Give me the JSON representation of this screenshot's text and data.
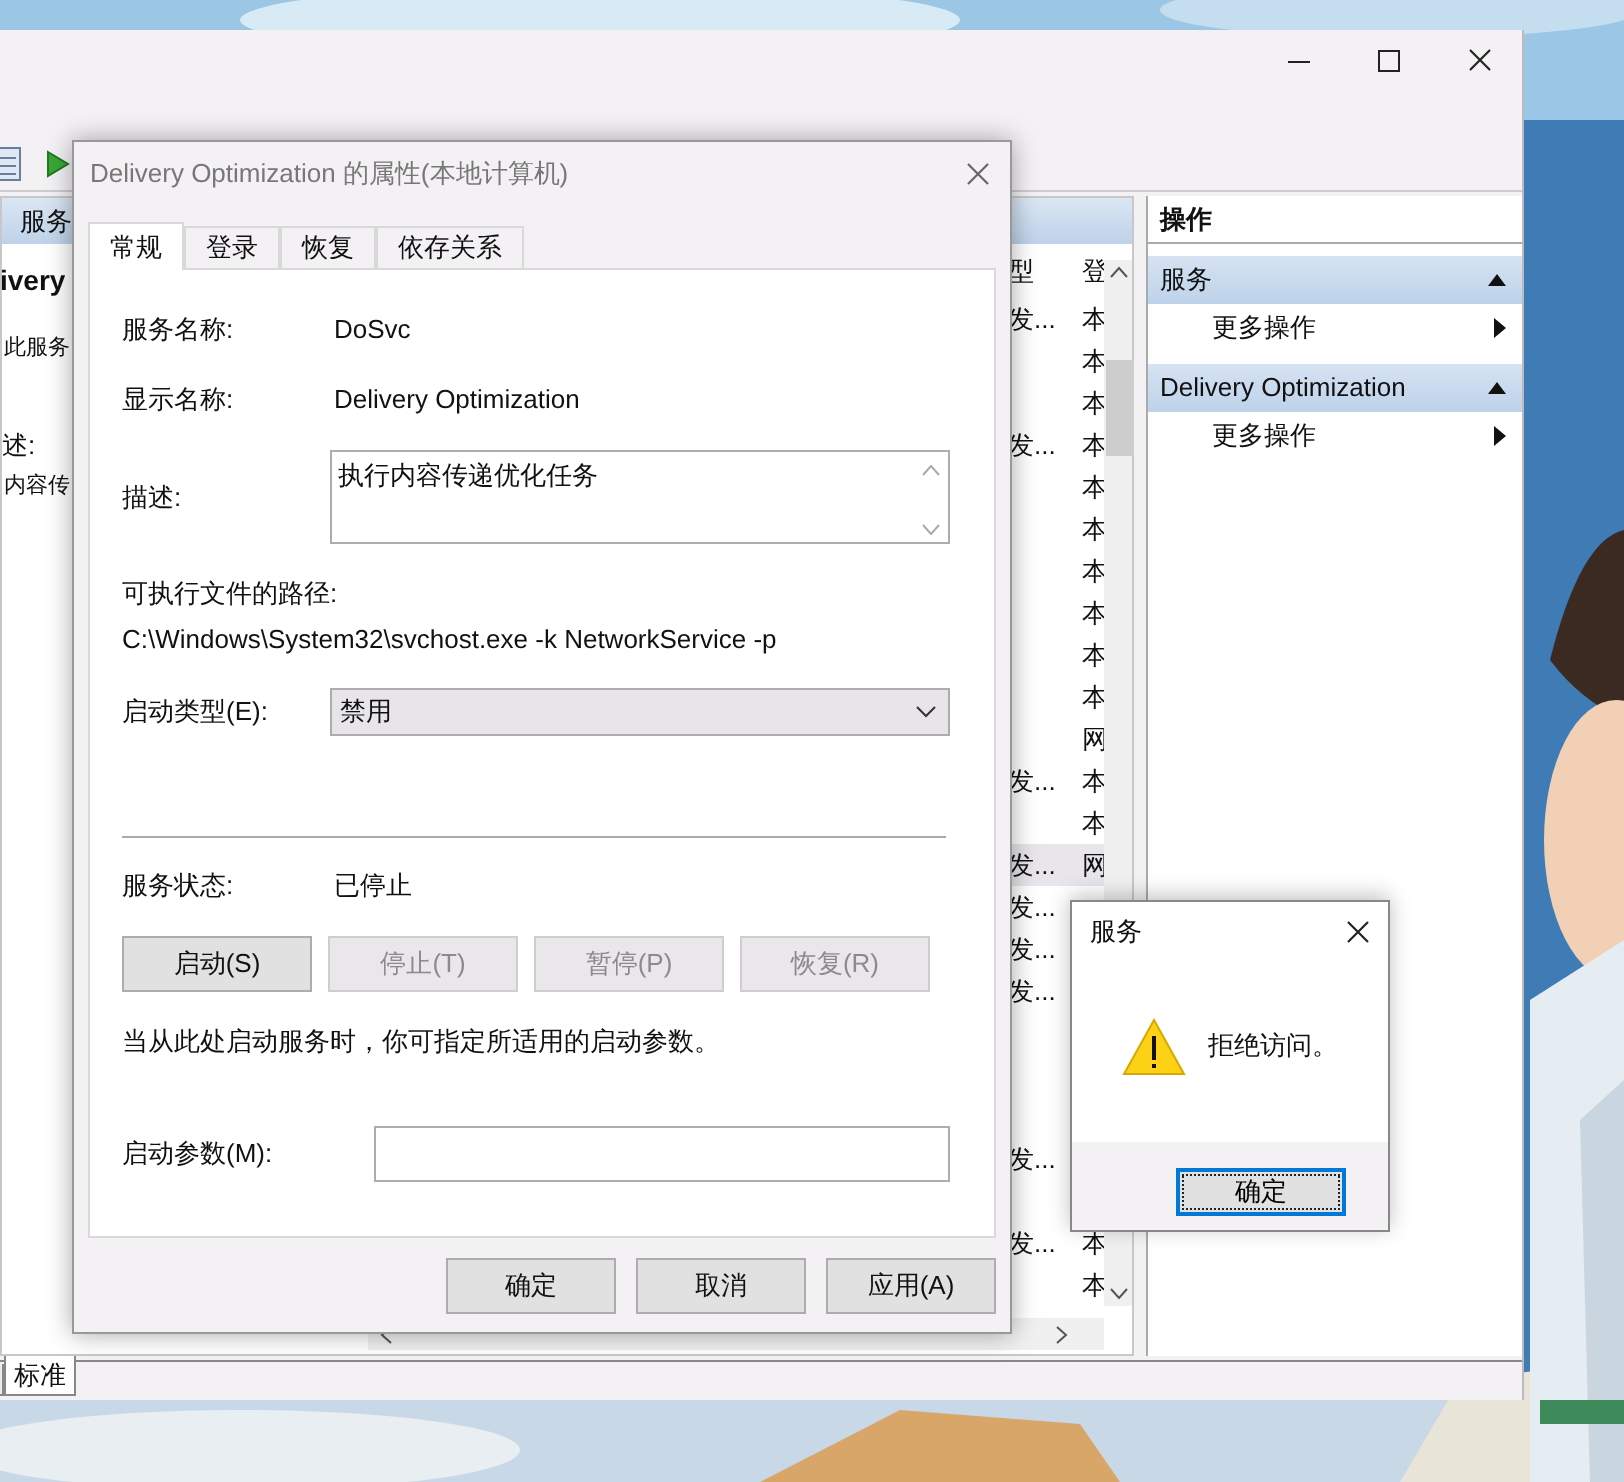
{
  "main_window": {
    "left_pane": {
      "header": "服务",
      "service_name": "ivery",
      "link": "此服务",
      "description_label": "述:",
      "description": "内容传"
    },
    "list": {
      "columns": [
        "型",
        "登"
      ],
      "rows": [
        {
          "column_1": "发...",
          "column_2": "本",
          "selected": false
        },
        {
          "column_2": "本",
          "selected": false
        },
        {
          "column_2": "本",
          "selected": false
        },
        {
          "column_1": "发...",
          "column_2": "本",
          "selected": false
        },
        {
          "column_2": "本",
          "selected": false
        },
        {
          "column_2": "本",
          "selected": false
        },
        {
          "column_2": "本",
          "selected": false
        },
        {
          "column_2": "本",
          "selected": false
        },
        {
          "column_2": "本",
          "selected": false
        },
        {
          "column_2": "本",
          "selected": false
        },
        {
          "column_2": "网",
          "selected": false
        },
        {
          "column_1": "发...",
          "column_2": "本",
          "selected": false
        },
        {
          "column_2": "本",
          "selected": false
        },
        {
          "column_1": "发...",
          "column_2": "网",
          "selected": true
        },
        {
          "column_1": "发...",
          "selected": false
        },
        {
          "column_1": "发...",
          "selected": false
        },
        {
          "column_1": "发...",
          "selected": false
        },
        {
          "selected": false
        },
        {
          "selected": false
        },
        {
          "selected": false
        },
        {
          "column_1": "发...",
          "selected": false
        },
        {
          "selected": false
        },
        {
          "column_1": "发...",
          "column_2": "本",
          "selected": false
        },
        {
          "column_2": "本",
          "selected": false
        }
      ]
    },
    "actions": {
      "title": "操作",
      "sections": [
        {
          "title": "服务",
          "expanded": true,
          "items": [
            "更多操作"
          ]
        },
        {
          "title": "Delivery Optimization",
          "expanded": true,
          "items": [
            "更多操作"
          ]
        }
      ]
    },
    "bottom_tabs": [
      {
        "selected": false
      },
      {
        "label": "标准",
        "selected": true
      }
    ]
  },
  "properties_dialog": {
    "title": "Delivery Optimization 的属性(本地计算机)",
    "tabs": [
      {
        "label": "常规",
        "selected": true
      },
      {
        "label": "登录",
        "selected": false
      },
      {
        "label": "恢复",
        "selected": false
      },
      {
        "label": "依存关系",
        "selected": false
      }
    ],
    "fields": [
      {
        "label": "服务名称:",
        "value": "DoSvc"
      },
      {
        "label": "显示名称:",
        "value": "Delivery Optimization"
      }
    ],
    "description": {
      "label": "描述:",
      "value": "执行内容传递优化任务"
    },
    "path": {
      "label": "可执行文件的路径:",
      "value": "C:\\Windows\\System32\\svchost.exe -k NetworkService -p"
    },
    "startup_type": {
      "label": "启动类型(E):",
      "value": "禁用"
    },
    "status": {
      "label": "服务状态:",
      "value": "已停止"
    },
    "service_buttons": [
      {
        "label": "启动(S)",
        "disabled": false
      },
      {
        "label": "停止(T)",
        "disabled": true
      },
      {
        "label": "暂停(P)",
        "disabled": true
      },
      {
        "label": "恢复(R)",
        "disabled": true
      }
    ],
    "hint": "当从此处启动服务时，你可指定所适用的启动参数。",
    "start_params": {
      "label": "启动参数(M):"
    },
    "buttons": [
      "确定",
      "取消",
      "应用(A)"
    ]
  },
  "alert": {
    "title": "服务",
    "message": "拒绝访问。",
    "button": "确定"
  }
}
